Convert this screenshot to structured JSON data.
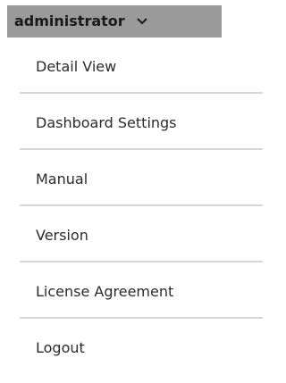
{
  "user_menu": {
    "username": "administrator",
    "toggle_icon": "chevron-down-icon"
  },
  "menu": {
    "items": [
      {
        "label": "Detail View"
      },
      {
        "label": "Dashboard Settings"
      },
      {
        "label": "Manual"
      },
      {
        "label": "Version"
      },
      {
        "label": "License Agreement"
      },
      {
        "label": "Logout"
      }
    ]
  }
}
